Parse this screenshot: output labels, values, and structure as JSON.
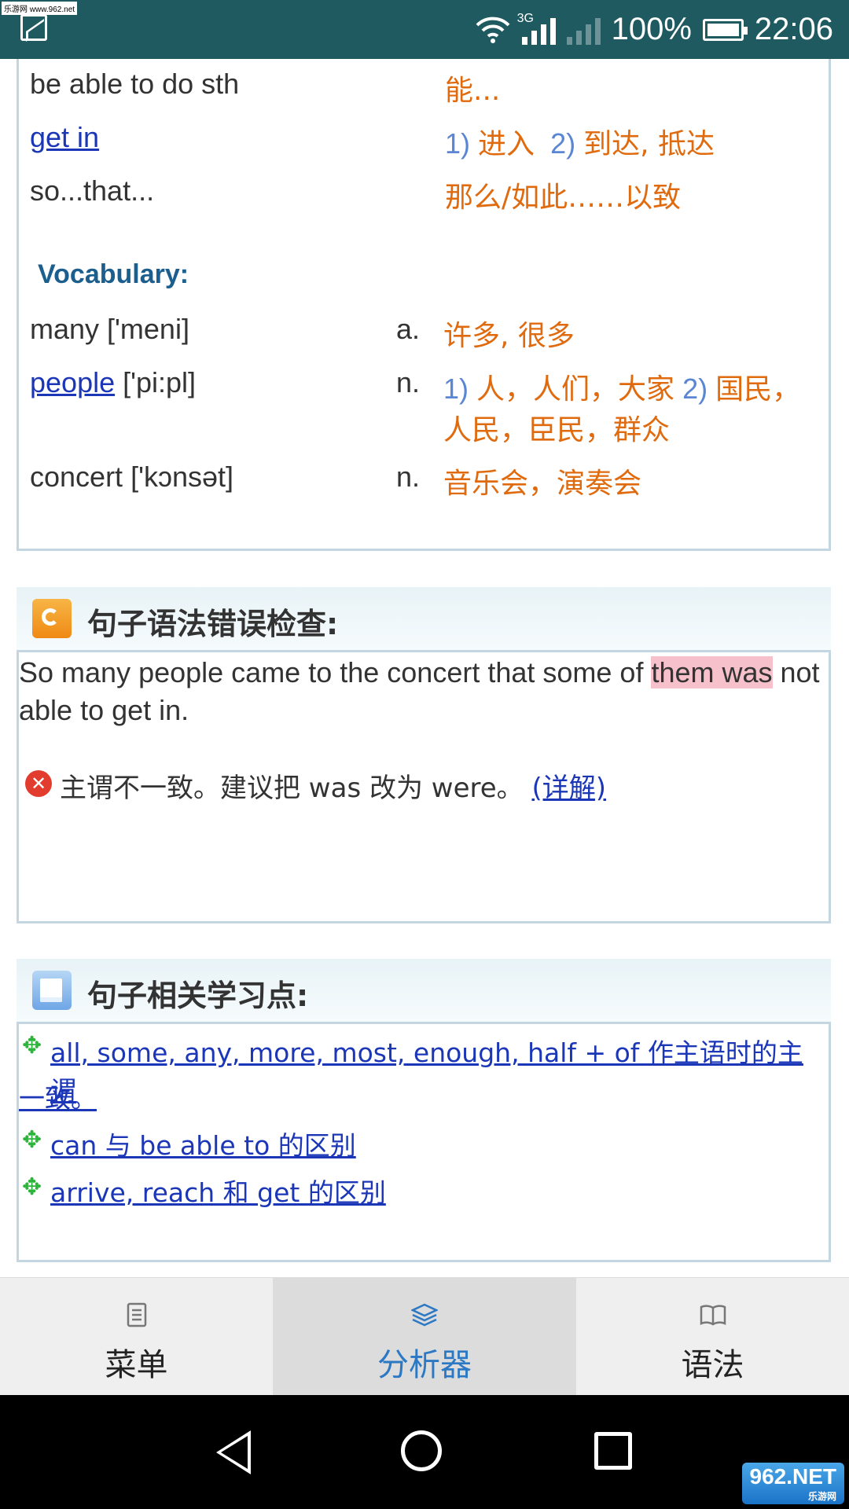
{
  "status": {
    "watermark": "乐游网 www.962.net",
    "network": "3G",
    "battery": "100%",
    "time": "22:06"
  },
  "phrases": [
    {
      "en": "be able to do sth",
      "cn": "能..."
    },
    {
      "en": "get in",
      "n1": "1)",
      "cn1": "进入",
      "n2": "2)",
      "cn2": "到达, 抵达"
    },
    {
      "en": "so...that...",
      "cn": "那么/如此……以致"
    }
  ],
  "vocabulary": {
    "heading": "Vocabulary:",
    "items": [
      {
        "word": "many",
        "phon": "['meni]",
        "pos": "a.",
        "cn": "许多, 很多"
      },
      {
        "word": "people",
        "phon": "['pi:pl]",
        "pos": "n.",
        "n1": "1)",
        "cn1": "人，人们，大家",
        "n2": "2)",
        "cn2": "国民，",
        "cn3": "人民，臣民，群众"
      },
      {
        "word": "concert",
        "phon": "['kɔnsət]",
        "pos": "n.",
        "cn": "音乐会，演奏会"
      }
    ]
  },
  "grammar_check": {
    "title": "句子语法错误检查:",
    "sentence_pre": "So many people came to the concert that some of ",
    "sentence_hl": "them was",
    "sentence_post": " not",
    "sentence_line2": "able to get in.",
    "error_msg": "主谓不一致。建议把 was 改为 were。",
    "detail_link": "(详解)"
  },
  "learning_points": {
    "title": "句子相关学习点:",
    "items": [
      {
        "line1": "all, some, any, more, most, enough, half + of 作主语时的主谓",
        "line2": "一致。"
      },
      {
        "line1": "can 与 be able to 的区别"
      },
      {
        "line1": "arrive, reach 和 get 的区别"
      }
    ]
  },
  "tabs": [
    {
      "label": "菜单",
      "icon": "list-icon"
    },
    {
      "label": "分析器",
      "icon": "layers-icon"
    },
    {
      "label": "语法",
      "icon": "book-icon"
    }
  ],
  "colors": {
    "accent": "#2b78c4",
    "chinese": "#e06a0e",
    "link": "#1b37b8",
    "statusbar": "#1f5a61"
  }
}
